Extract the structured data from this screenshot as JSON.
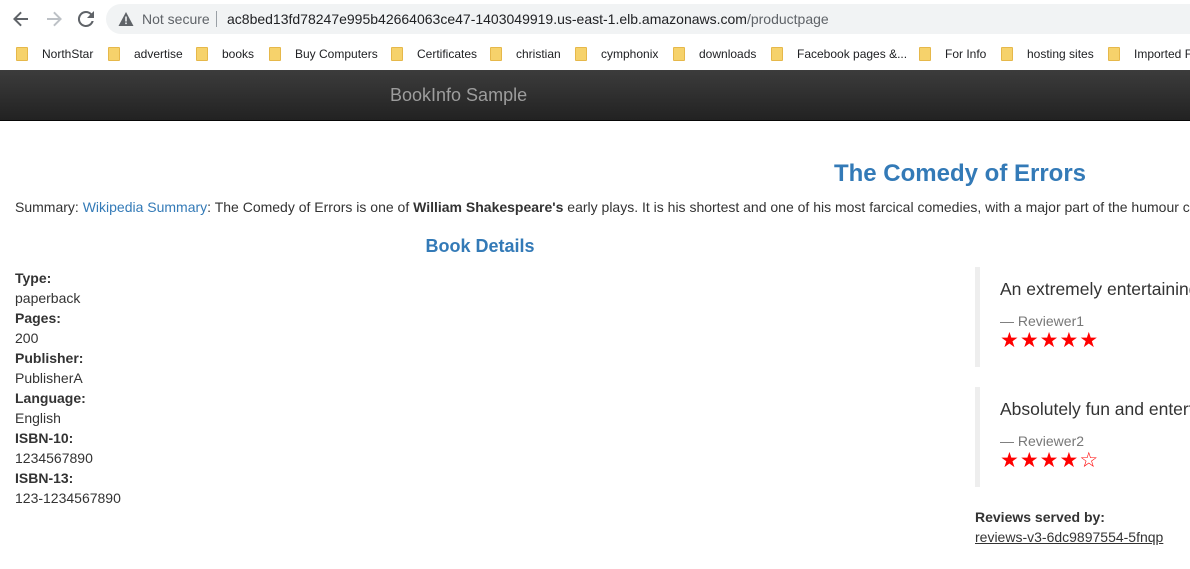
{
  "browser": {
    "security_label": "Not secure",
    "url_host": "ac8bed13fd78247e995b42664063ce47-1403049919.us-east-1.elb.amazonaws.com",
    "url_path": "/productpage",
    "bookmarks": [
      "NorthStar",
      "advertise",
      "books",
      "Buy Computers",
      "Certificates",
      "christian",
      "cymphonix",
      "downloads",
      "Facebook pages &...",
      "For Info",
      "hosting sites",
      "Imported Fr"
    ]
  },
  "header": {
    "brand": "BookInfo Sample"
  },
  "book": {
    "title": "The Comedy of Errors",
    "summary_label": "Summary:",
    "summary_link": "Wikipedia Summary",
    "summary_pre": ": The Comedy of Errors is one of ",
    "summary_bold": "William Shakespeare's",
    "summary_post": " early plays. It is his shortest and one of his most farcical comedies, with a major part of the humour coming from slapstick and mistaken identity, in addition to puns and word play."
  },
  "details": {
    "heading": "Book Details",
    "items": [
      {
        "label": "Type:",
        "value": "paperback"
      },
      {
        "label": "Pages:",
        "value": "200"
      },
      {
        "label": "Publisher:",
        "value": "PublisherA"
      },
      {
        "label": "Language:",
        "value": "English"
      },
      {
        "label": "ISBN-10:",
        "value": "1234567890"
      },
      {
        "label": "ISBN-13:",
        "value": "123-1234567890"
      }
    ]
  },
  "reviews": {
    "items": [
      {
        "text": "An extremely entertaining play by Shakespeare. The slapstick humour is refreshing!",
        "reviewer": "— Reviewer1",
        "rating": 5,
        "max_rating": 5
      },
      {
        "text": "Absolutely fun and entertaining. The play lacks thematic depth when compared to other plays by Shakespeare.",
        "reviewer": "— Reviewer2",
        "rating": 4,
        "max_rating": 5
      }
    ],
    "served_by_label": "Reviews served by:",
    "served_by_value": "reviews-v3-6dc9897554-5fnqp",
    "star_color": "#ff0000"
  }
}
